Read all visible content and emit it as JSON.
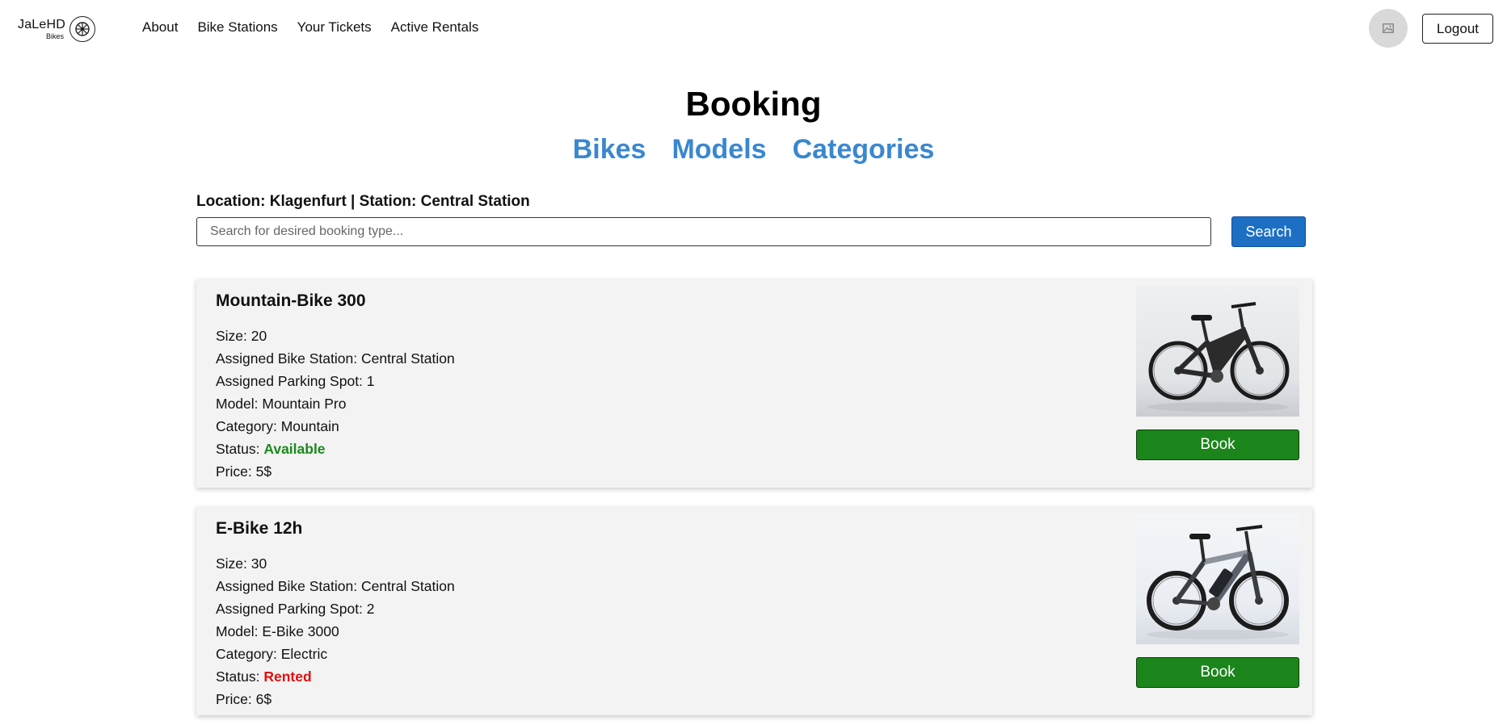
{
  "nav": {
    "logo_main": "JaLeHD",
    "logo_sub": "Bikes",
    "links": [
      "About",
      "Bike Stations",
      "Your Tickets",
      "Active Rentals"
    ],
    "logout_label": "Logout"
  },
  "page": {
    "title": "Booking",
    "tabs": [
      "Bikes",
      "Models",
      "Categories"
    ],
    "location_line": "Location: Klagenfurt | Station: Central Station"
  },
  "search": {
    "placeholder": "Search for desired booking type...",
    "button_label": "Search"
  },
  "bikes": [
    {
      "name": "Mountain-Bike 300",
      "size": "Size: 20",
      "station": "Assigned Bike Station: Central Station",
      "spot": "Assigned Parking Spot: 1",
      "model": "Model: Mountain Pro",
      "category": "Category: Mountain",
      "status_label": "Status: ",
      "status": "Available",
      "price": "Price: 5$",
      "button_label": "Book"
    },
    {
      "name": "E-Bike 12h",
      "size": "Size: 30",
      "station": "Assigned Bike Station: Central Station",
      "spot": "Assigned Parking Spot: 2",
      "model": "Model: E-Bike 3000",
      "category": "Category: Electric",
      "status_label": "Status: ",
      "status": "Rented",
      "price": "Price: 6$",
      "button_label": "Book"
    }
  ],
  "colors": {
    "link_blue": "#3a87d0",
    "search_blue": "#1d6fc4",
    "book_green": "#1b851b",
    "available_green": "#1a8a1a",
    "rented_red": "#e01010",
    "card_bg": "#f3f3f3"
  },
  "icons": {
    "logo": "bike-wheel-icon",
    "avatar": "image-placeholder-icon"
  }
}
